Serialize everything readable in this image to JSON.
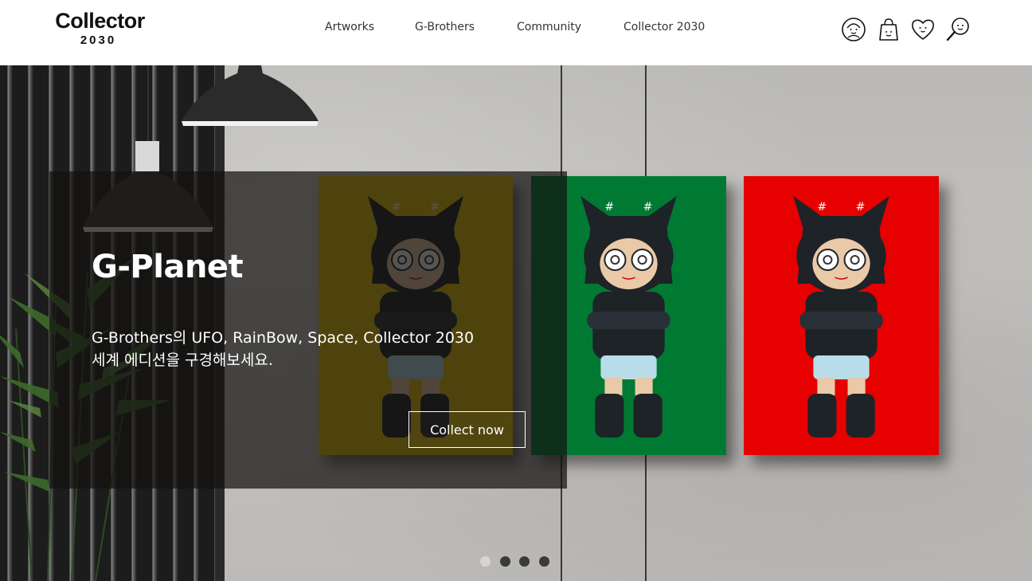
{
  "logo": {
    "main": "Collector",
    "sub": "2030"
  },
  "nav": {
    "items": [
      {
        "label": "Artworks"
      },
      {
        "label": "G-Brothers"
      },
      {
        "label": "Community"
      },
      {
        "label": "Collector 2030"
      }
    ]
  },
  "header_icons": [
    "user-face-icon",
    "shopping-bag-icon",
    "heart-icon",
    "search-icon"
  ],
  "hero": {
    "title": "G-Planet",
    "description_line1": "G-Brothers의 UFO, RainBow, Space, Collector 2030",
    "description_line2": "세계 에디션을 구경해보세요.",
    "cta_label": "Collect now"
  },
  "artworks": [
    {
      "background_color": "#e7c300"
    },
    {
      "background_color": "#007a33"
    },
    {
      "background_color": "#e60000"
    }
  ],
  "carousel": {
    "slide_count": 4,
    "active_index": 0
  }
}
